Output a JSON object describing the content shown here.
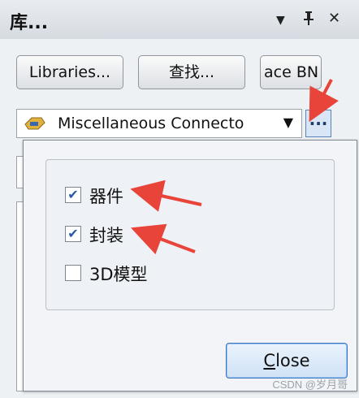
{
  "panel": {
    "title": "库...",
    "controls": {
      "menu": "▼",
      "pin": "📌",
      "close": "✕"
    }
  },
  "buttons": {
    "libraries": "Libraries...",
    "search": "查找...",
    "place": "ace BN"
  },
  "library_combo": {
    "selected": "Miscellaneous Connecto",
    "dropdown_arrow": "▼",
    "more_button": "..."
  },
  "popup": {
    "options": [
      {
        "label": "器件",
        "checked": true
      },
      {
        "label": "封装",
        "checked": true
      },
      {
        "label": "3D模型",
        "checked": false
      }
    ],
    "close_label_first": "C",
    "close_label_rest": "lose"
  },
  "annotation_color": "#e8443a",
  "watermark": "CSDN @岁月哥"
}
